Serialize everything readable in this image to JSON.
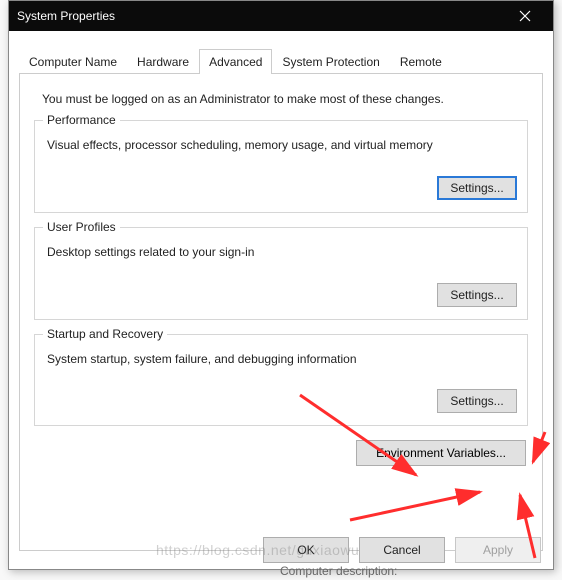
{
  "window": {
    "title": "System Properties"
  },
  "tabs": {
    "items": [
      {
        "label": "Computer Name"
      },
      {
        "label": "Hardware"
      },
      {
        "label": "Advanced"
      },
      {
        "label": "System Protection"
      },
      {
        "label": "Remote"
      }
    ],
    "active": 2
  },
  "adminNote": "You must be logged on as an Administrator to make most of these changes.",
  "groups": {
    "performance": {
      "label": "Performance",
      "desc": "Visual effects, processor scheduling, memory usage, and virtual memory",
      "button": "Settings..."
    },
    "userProfiles": {
      "label": "User Profiles",
      "desc": "Desktop settings related to your sign-in",
      "button": "Settings..."
    },
    "startup": {
      "label": "Startup and Recovery",
      "desc": "System startup, system failure, and debugging information",
      "button": "Settings..."
    }
  },
  "envButton": "Environment Variables...",
  "buttons": {
    "ok": "OK",
    "cancel": "Cancel",
    "apply": "Apply"
  },
  "background": {
    "desc": "Computer description:"
  },
  "annotation": {
    "arrows": 3,
    "color": "#ff2d2d",
    "target": "Environment Variables..."
  }
}
